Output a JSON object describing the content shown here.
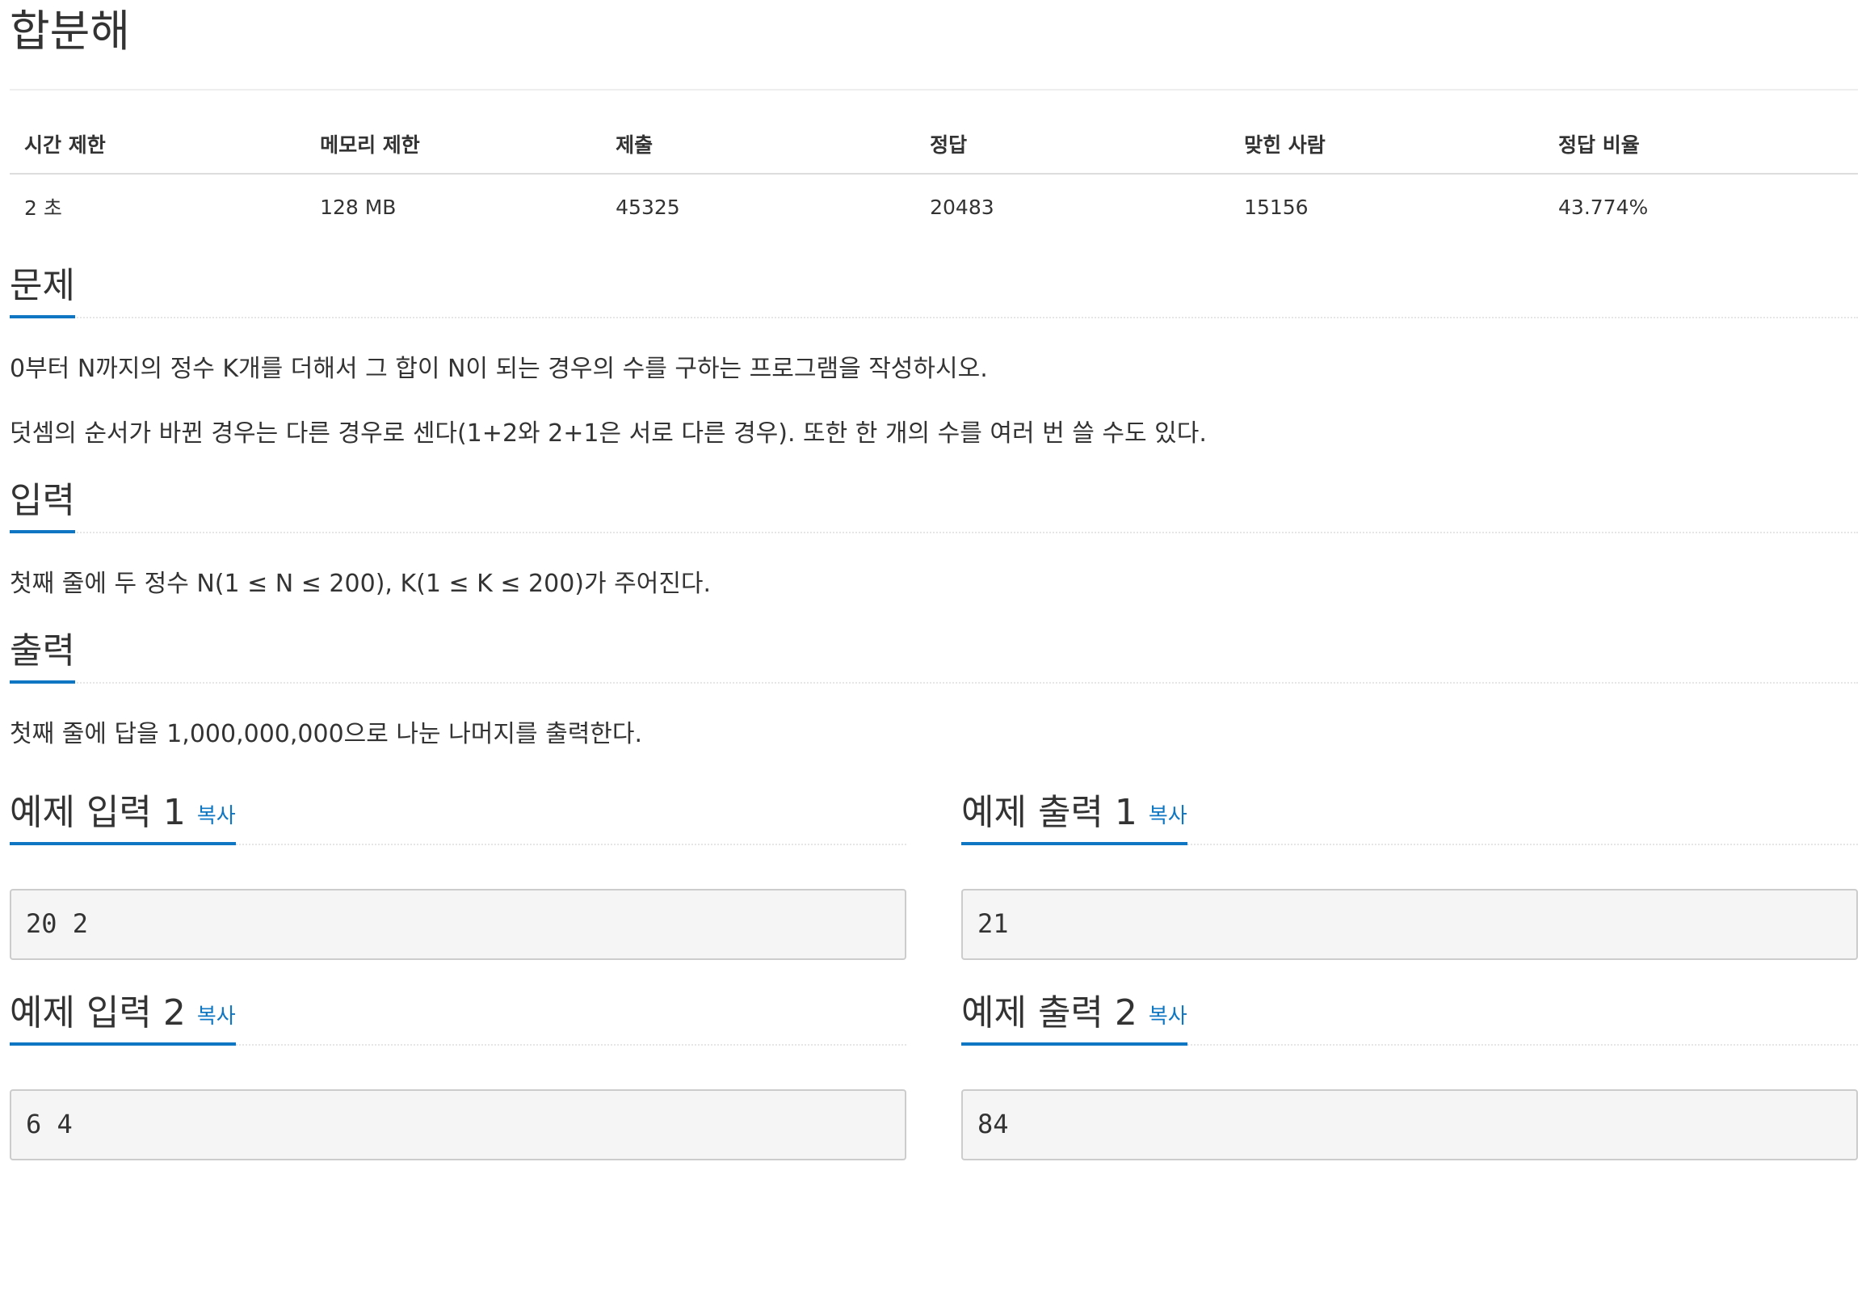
{
  "title": "합분해",
  "info_table": {
    "headers": [
      "시간 제한",
      "메모리 제한",
      "제출",
      "정답",
      "맞힌 사람",
      "정답 비율"
    ],
    "values": [
      "2 초",
      "128 MB",
      "45325",
      "20483",
      "15156",
      "43.774%"
    ]
  },
  "sections": {
    "problem": {
      "heading": "문제",
      "paragraphs": [
        "0부터 N까지의 정수 K개를 더해서 그 합이 N이 되는 경우의 수를 구하는 프로그램을 작성하시오.",
        "덧셈의 순서가 바뀐 경우는 다른 경우로 센다(1+2와 2+1은 서로 다른 경우). 또한 한 개의 수를 여러 번 쓸 수도 있다."
      ]
    },
    "input": {
      "heading": "입력",
      "paragraph": "첫째 줄에 두 정수 N(1 ≤ N ≤ 200), K(1 ≤ K ≤ 200)가 주어진다."
    },
    "output": {
      "heading": "출력",
      "paragraph": "첫째 줄에 답을 1,000,000,000으로 나눈 나머지를 출력한다."
    }
  },
  "copy_label": "복사",
  "samples": [
    {
      "input_heading": "예제 입력 1",
      "input": "20 2",
      "output_heading": "예제 출력 1",
      "output": "21"
    },
    {
      "input_heading": "예제 입력 2",
      "input": "6 4",
      "output_heading": "예제 출력 2",
      "output": "84"
    }
  ],
  "colors": {
    "accent": "#0e76c2",
    "text": "#333333",
    "sample_bg": "#f5f5f5"
  }
}
